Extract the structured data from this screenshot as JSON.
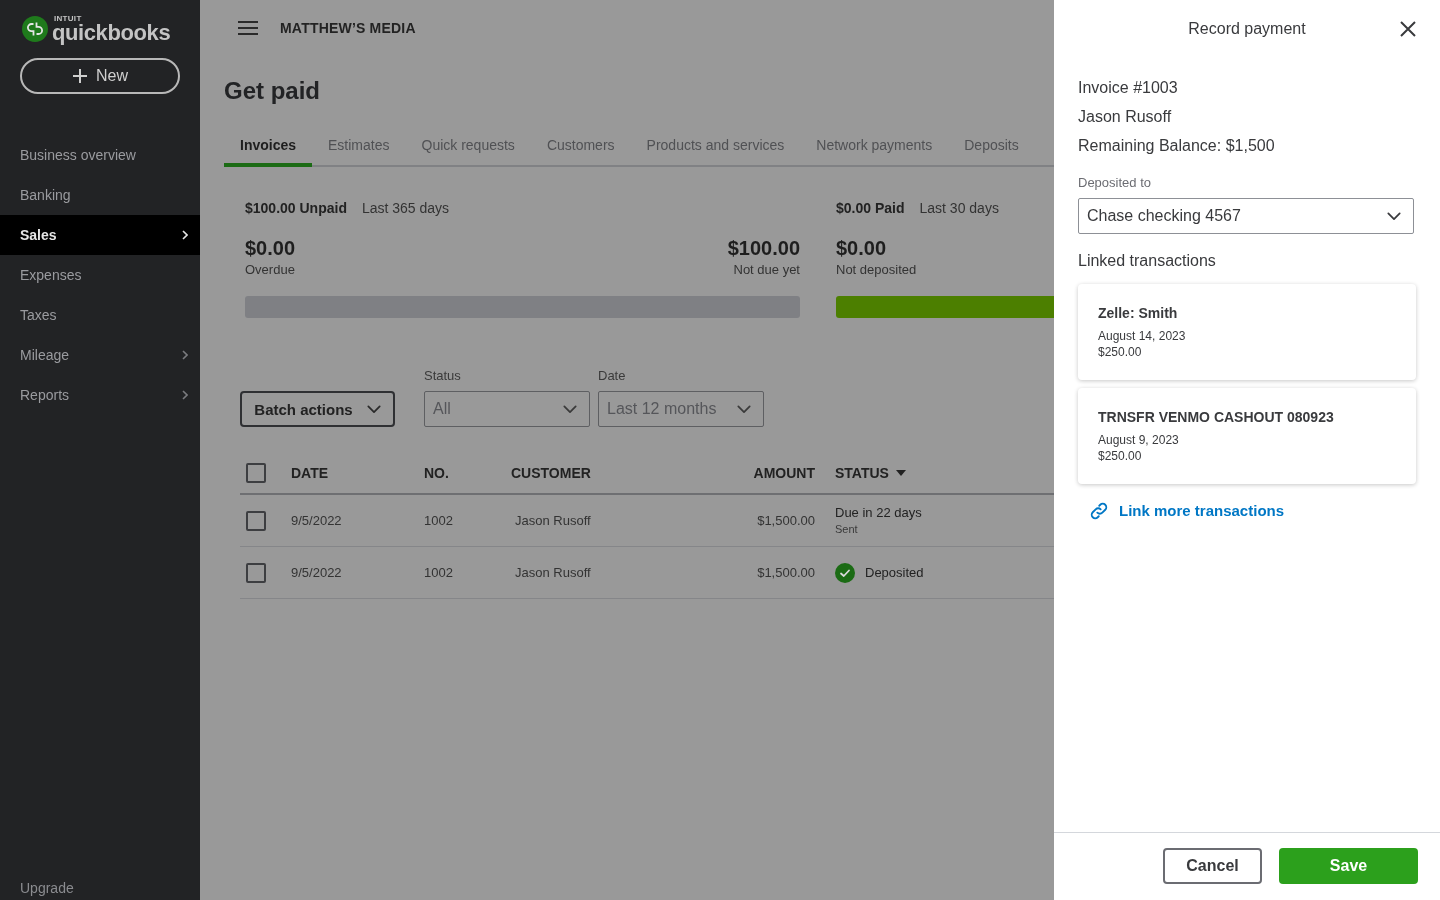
{
  "sidebar": {
    "logo": {
      "company": "INTUIT",
      "product": "quickbooks"
    },
    "new_button": "New",
    "items": [
      {
        "label": "Business overview",
        "selected": false,
        "submenu": false
      },
      {
        "label": "Banking",
        "selected": false,
        "submenu": false
      },
      {
        "label": "Sales",
        "selected": true,
        "submenu": true
      },
      {
        "label": "Expenses",
        "selected": false,
        "submenu": false
      },
      {
        "label": "Taxes",
        "selected": false,
        "submenu": false
      },
      {
        "label": "Mileage",
        "selected": false,
        "submenu": true
      },
      {
        "label": "Reports",
        "selected": false,
        "submenu": true
      }
    ],
    "footer_item": "Upgrade"
  },
  "header": {
    "company": "MATTHEW’S MEDIA"
  },
  "page": {
    "title": "Get paid",
    "tabs": [
      {
        "label": "Invoices",
        "selected": true
      },
      {
        "label": "Estimates",
        "selected": false
      },
      {
        "label": "Quick requests",
        "selected": false
      },
      {
        "label": "Customers",
        "selected": false
      },
      {
        "label": "Products and services",
        "selected": false
      },
      {
        "label": "Network payments",
        "selected": false
      },
      {
        "label": "Deposits",
        "selected": false
      }
    ],
    "summaries": [
      {
        "kind": "unpaid",
        "headline": "$100.00 Unpaid",
        "period": "Last 365 days",
        "stats": [
          {
            "amount": "$0.00",
            "label": "Overdue"
          },
          {
            "amount": "$100.00",
            "label": "Not due yet"
          }
        ],
        "level": 1
      },
      {
        "kind": "paid",
        "headline": "$0.00 Paid",
        "period": "Last 30 days",
        "stats": [
          {
            "amount": "$0.00",
            "label": "Not deposited"
          }
        ],
        "level": 1
      }
    ],
    "filters": {
      "batch_actions": "Batch actions",
      "dropdowns": [
        {
          "label": "Status",
          "value": "All"
        },
        {
          "label": "Date",
          "value": "Last 12 months"
        }
      ]
    },
    "table": {
      "select_all_checked": false,
      "columns": [
        {
          "label": "DATE",
          "sorted": false
        },
        {
          "label": "NO.",
          "sorted": false
        },
        {
          "label": "CUSTOMER",
          "sorted": false
        },
        {
          "label": "AMOUNT",
          "sorted": false
        },
        {
          "label": "STATUS",
          "sorted": true
        }
      ],
      "rows": [
        {
          "checked": false,
          "date": "9/5/2022",
          "number": "1002",
          "customer": "Jason Rusoff",
          "amount": "$1,500.00",
          "status": {
            "kind": "due",
            "text": "Due in 22 days",
            "subtext": "Sent"
          }
        },
        {
          "checked": false,
          "date": "9/5/2022",
          "number": "1002",
          "customer": "Jason Rusoff",
          "amount": "$1,500.00",
          "status": {
            "kind": "deposited",
            "text": "Deposited"
          }
        }
      ]
    }
  },
  "drawer": {
    "title": "Record payment",
    "invoice": "Invoice #1003",
    "customer": "Jason Rusoff",
    "balance": "Remaining Balance: $1,500",
    "deposit": {
      "label": "Deposited to",
      "value": "Chase checking 4567"
    },
    "linked_heading": "Linked transactions",
    "transactions": [
      {
        "name": "Zelle: Smith",
        "date": "August 14, 2023",
        "amount": "$250.00"
      },
      {
        "name": "TRNSFR VENMO CASHOUT 080923",
        "date": "August 9, 2023",
        "amount": "$250.00"
      }
    ],
    "link_more": "Link more transactions",
    "buttons": [
      {
        "label": "Cancel",
        "kind": "secondary"
      },
      {
        "label": "Save",
        "kind": "primary"
      }
    ]
  }
}
